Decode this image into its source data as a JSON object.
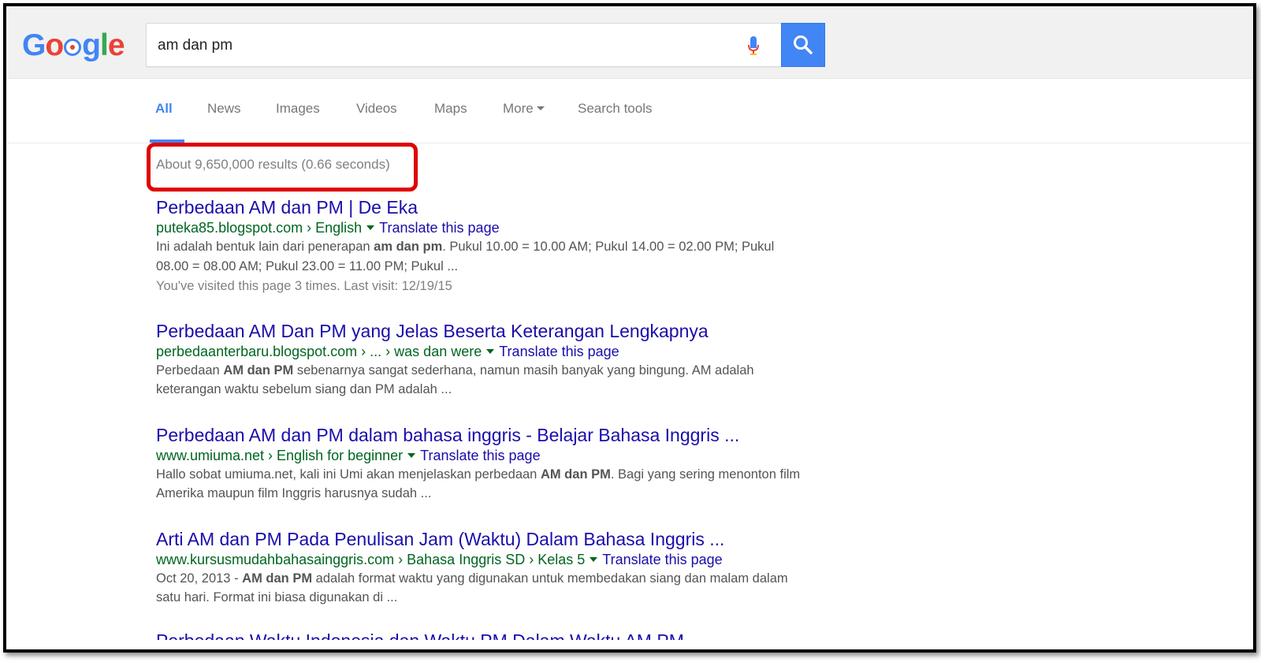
{
  "search": {
    "query": "am dan pm"
  },
  "tabs": [
    {
      "label": "All"
    },
    {
      "label": "News"
    },
    {
      "label": "Images"
    },
    {
      "label": "Videos"
    },
    {
      "label": "Maps"
    },
    {
      "label": "More"
    },
    {
      "label": "Search tools"
    }
  ],
  "stats": "About 9,650,000 results (0.66 seconds)",
  "results": [
    {
      "title": "Perbedaan AM dan PM | De Eka",
      "url": "puteka85.blogspot.com › English",
      "translate": "Translate this page",
      "snippet_parts": [
        "Ini adalah bentuk lain dari penerapan ",
        "am dan pm",
        ". Pukul 10.00 = 10.00 AM; Pukul 14.00 = 02.00 PM; Pukul 08.00 = 08.00 AM; Pukul 23.00 = 11.00 PM; Pukul ..."
      ],
      "visited": "You've visited this page 3 times. Last visit: 12/19/15"
    },
    {
      "title": "Perbedaan AM Dan PM yang Jelas Beserta Keterangan Lengkapnya",
      "url": "perbedaanterbaru.blogspot.com › ... › was dan were",
      "translate": "Translate this page",
      "snippet_parts": [
        "Perbedaan ",
        "AM dan PM",
        " sebenarnya sangat sederhana, namun masih banyak yang bingung. AM adalah keterangan waktu sebelum siang dan PM adalah ..."
      ]
    },
    {
      "title": "Perbedaan AM dan PM dalam bahasa inggris - Belajar Bahasa Inggris ...",
      "url": "www.umiuma.net › English for beginner",
      "translate": "Translate this page",
      "snippet_parts": [
        "Hallo sobat umiuma.net, kali ini Umi akan menjelaskan perbedaan ",
        "AM dan PM",
        ". Bagi yang sering menonton film Amerika maupun film Inggris harusnya sudah ..."
      ]
    },
    {
      "title": "Arti AM dan PM Pada Penulisan Jam (Waktu) Dalam Bahasa Inggris ...",
      "url": "www.kursusmudahbahasainggris.com › Bahasa Inggris SD › Kelas 5",
      "translate": "Translate this page",
      "snippet_parts": [
        "Oct 20, 2013 - ",
        "AM dan PM",
        " adalah format waktu yang digunakan untuk membedakan siang dan malam dalam satu hari. Format ini biasa digunakan di ..."
      ]
    }
  ],
  "partial_title": "Perbedaan Waktu Indonesia dan Waktu PM Dalam Waktu AM PM",
  "colors": {
    "link": "#1a0dab",
    "url": "#006621",
    "accent": "#4285f4",
    "highlight": "#e00000"
  }
}
